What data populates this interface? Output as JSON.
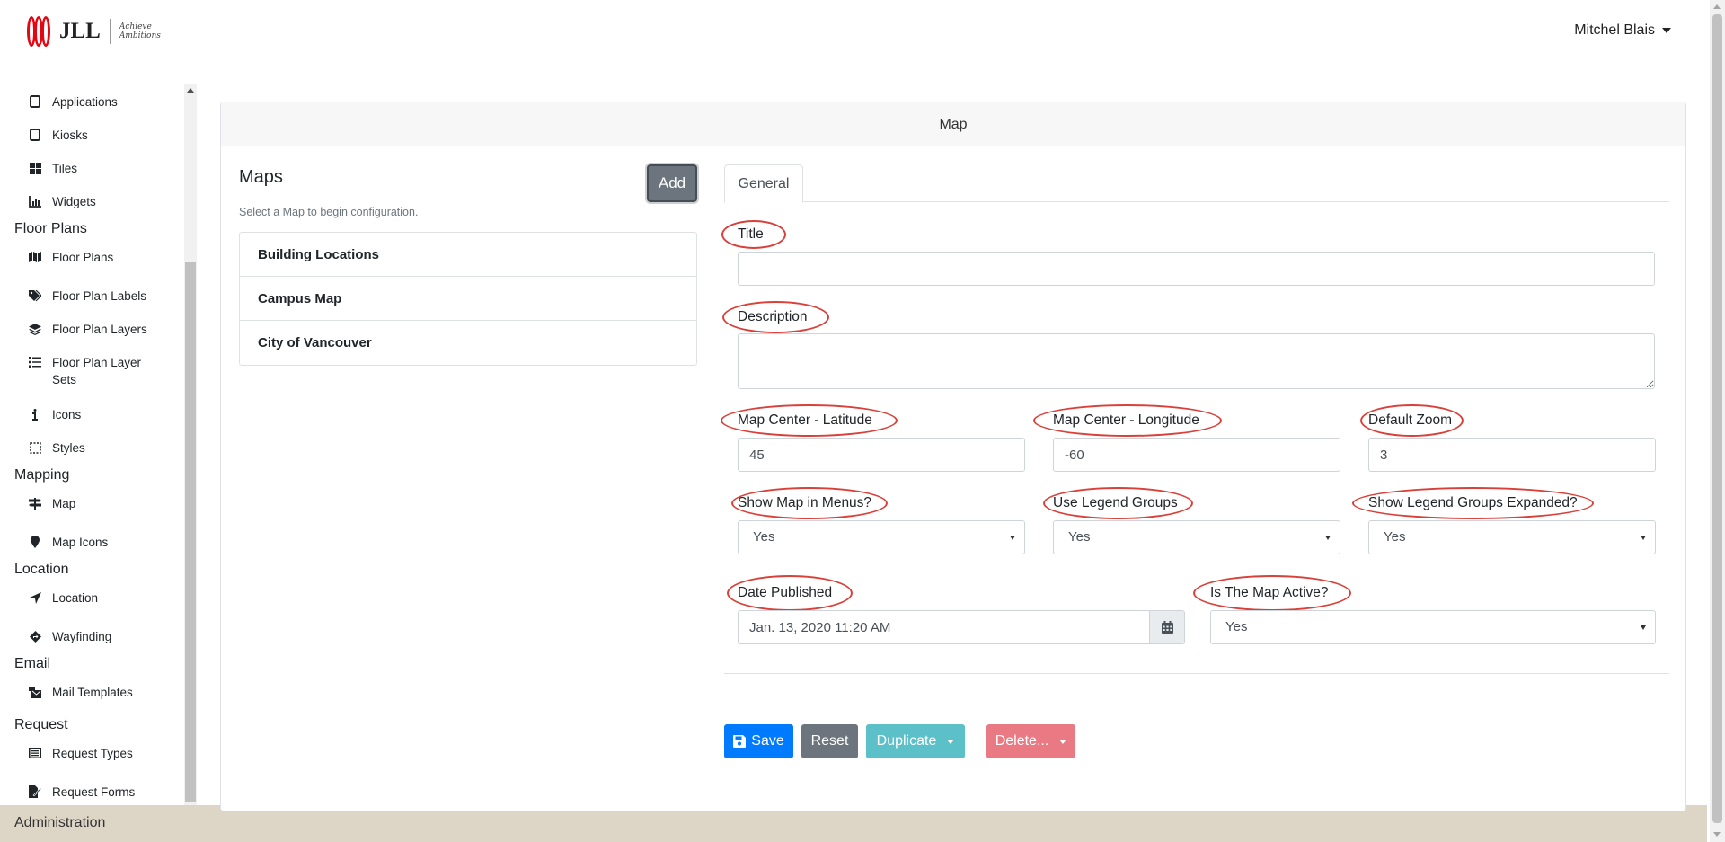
{
  "header": {
    "brand": "JLL",
    "tagline_line1": "Achieve",
    "tagline_line2": "Ambitions",
    "user": "Mitchel Blais"
  },
  "sidebar": {
    "items_top": [
      {
        "label": "Applications",
        "icon": "tablet-icon"
      },
      {
        "label": "Kiosks",
        "icon": "tablet-icon"
      },
      {
        "label": "Tiles",
        "icon": "tiles-icon"
      },
      {
        "label": "Widgets",
        "icon": "chart-icon"
      }
    ],
    "floor_plans": {
      "heading": "Floor Plans",
      "items": [
        {
          "label": "Floor Plans",
          "icon": "map-icon"
        },
        {
          "label": "Floor Plan Labels",
          "icon": "tags-icon"
        },
        {
          "label": "Floor Plan Layers",
          "icon": "layers-icon"
        },
        {
          "label": "Floor Plan Layer Sets",
          "icon": "list-icon"
        },
        {
          "label": "Icons",
          "icon": "info-icon"
        },
        {
          "label": "Styles",
          "icon": "styles-icon"
        }
      ]
    },
    "mapping": {
      "heading": "Mapping",
      "items": [
        {
          "label": "Map",
          "icon": "signs-icon"
        },
        {
          "label": "Map Icons",
          "icon": "marker-icon"
        }
      ]
    },
    "location": {
      "heading": "Location",
      "items": [
        {
          "label": "Location",
          "icon": "location-arrow-icon"
        },
        {
          "label": "Wayfinding",
          "icon": "directions-icon"
        }
      ]
    },
    "email": {
      "heading": "Email",
      "items": [
        {
          "label": "Mail Templates",
          "icon": "mail-bulk-icon"
        }
      ]
    },
    "request": {
      "heading": "Request",
      "items": [
        {
          "label": "Request Types",
          "icon": "list-alt-icon"
        },
        {
          "label": "Request Forms",
          "icon": "file-signature-icon"
        }
      ]
    }
  },
  "footer": {
    "label": "Administration"
  },
  "card": {
    "title": "Map"
  },
  "maps_panel": {
    "title": "Maps",
    "add_label": "Add",
    "subtitle": "Select a Map to begin configuration.",
    "items": [
      "Building Locations",
      "Campus Map",
      "City of Vancouver"
    ]
  },
  "form": {
    "tab": "General",
    "title_label": "Title",
    "title_value": "",
    "description_label": "Description",
    "description_value": "",
    "lat_label": "Map Center - Latitude",
    "lat_value": "45",
    "lng_label": "Map Center - Longitude",
    "lng_value": "-60",
    "zoom_label": "Default Zoom",
    "zoom_value": "3",
    "show_menus_label": "Show Map in Menus?",
    "show_menus_value": "Yes",
    "legend_groups_label": "Use Legend Groups",
    "legend_groups_value": "Yes",
    "legend_expanded_label": "Show Legend Groups Expanded?",
    "legend_expanded_value": "Yes",
    "date_label": "Date Published",
    "date_value": "Jan. 13, 2020 11:20 AM",
    "active_label": "Is The Map Active?",
    "active_value": "Yes"
  },
  "actions": {
    "save": "Save",
    "reset": "Reset",
    "duplicate": "Duplicate",
    "delete": "Delete..."
  },
  "colors": {
    "primary": "#007bff",
    "secondary": "#6c757d",
    "info": "#5bc0c8",
    "danger": "#e97a84",
    "annotation": "#d9403a",
    "footer": "#ddd5c6"
  }
}
